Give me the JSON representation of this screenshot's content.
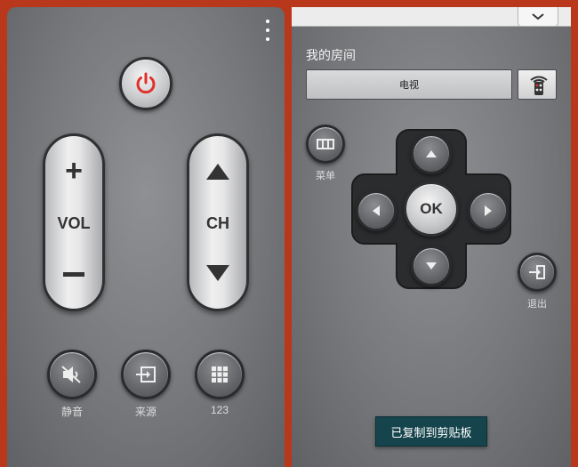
{
  "left_panel": {
    "volume": {
      "label": "VOL",
      "plus": "+",
      "minus": "–"
    },
    "channel": {
      "label": "CH"
    },
    "buttons": [
      {
        "id": "mute",
        "caption": "静音",
        "icon": "mute-icon"
      },
      {
        "id": "source",
        "caption": "来源",
        "icon": "source-input-icon"
      },
      {
        "id": "numpad",
        "caption": "123",
        "icon": "grid-icon"
      }
    ],
    "power_icon": "power-icon",
    "power_color": "#e0302a",
    "overflow_icon": "more-vertical-icon"
  },
  "right_panel": {
    "room_title": "我的房间",
    "device": "电视",
    "menu": {
      "caption": "菜单",
      "icon": "menu-icon"
    },
    "exit": {
      "caption": "退出",
      "icon": "exit-icon"
    },
    "ok_label": "OK",
    "toast": "已复制到剪贴板",
    "toast_color": "#16444d",
    "remote_icon": "remote-signal-icon"
  }
}
